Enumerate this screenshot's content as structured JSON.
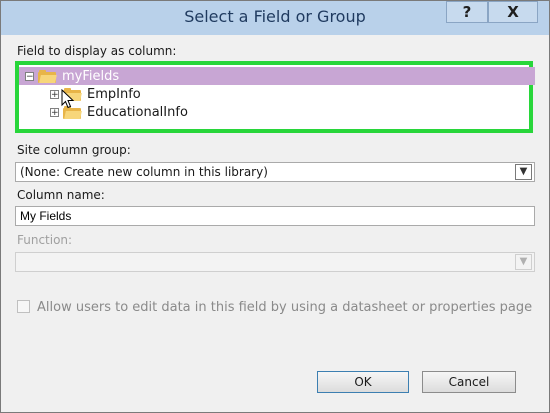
{
  "dialog": {
    "title": "Select a Field or Group",
    "help_label": "?",
    "close_label": "X"
  },
  "tree": {
    "label": "Field to display as column:",
    "root": {
      "label": "myFields",
      "expander": "⊟"
    },
    "children": [
      {
        "label": "EmpInfo",
        "expander": "⊞"
      },
      {
        "label": "EducationalInfo",
        "expander": "⊞"
      }
    ],
    "highlight_color": "#28d63a",
    "selected_color": "#c8a6d4"
  },
  "site_column_group": {
    "label": "Site column group:",
    "value": "(None: Create new column in this library)"
  },
  "column_name": {
    "label": "Column name:",
    "value": "My Fields"
  },
  "function": {
    "label": "Function:",
    "value": ""
  },
  "allow_edit": {
    "label": "Allow users to edit data in this field by using a datasheet or properties page",
    "checked": false
  },
  "buttons": {
    "ok": "OK",
    "cancel": "Cancel"
  }
}
